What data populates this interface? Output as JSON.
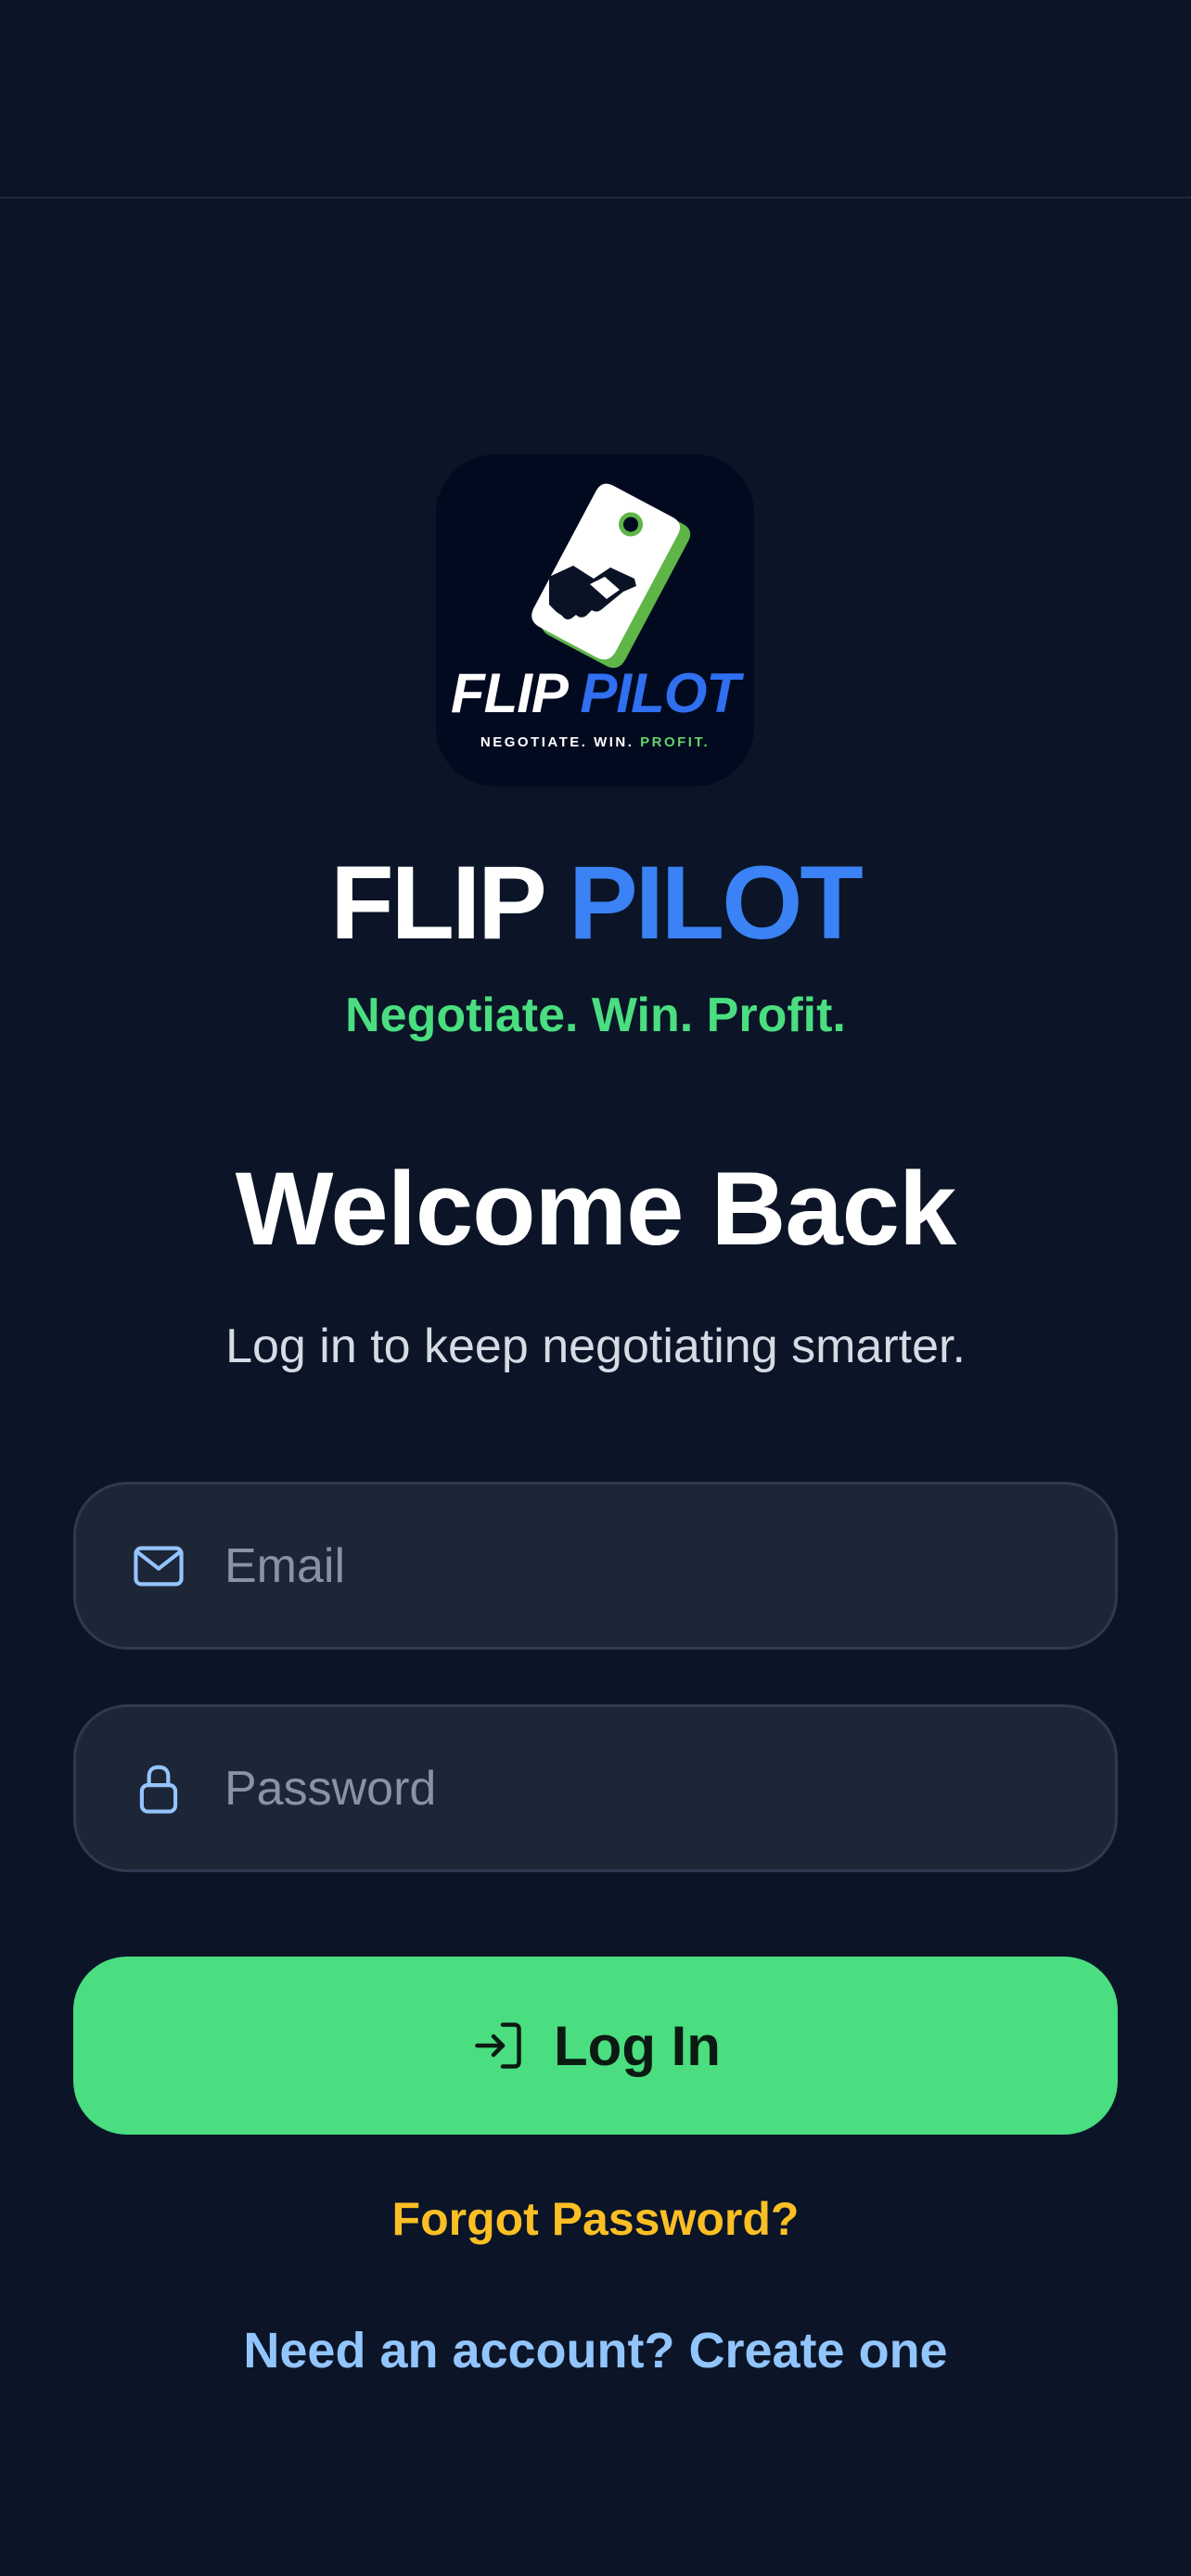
{
  "logo": {
    "word_part1": "FLIP",
    "word_part2": "PILOT",
    "sub_part1": "NEGOTIATE. WIN.",
    "sub_part2": "PROFIT.",
    "icon": "price-tag-handshake-icon"
  },
  "brand": {
    "title_part1": "FLIP",
    "title_part2": "PILOT",
    "tagline": "Negotiate. Win. Profit."
  },
  "heading": {
    "title": "Welcome Back",
    "subtitle": "Log in to keep negotiating smarter."
  },
  "form": {
    "email_placeholder": "Email",
    "email_value": "",
    "email_icon": "mail-icon",
    "password_placeholder": "Password",
    "password_value": "",
    "password_icon": "lock-icon"
  },
  "actions": {
    "login_label": "Log In",
    "login_icon": "log-in-icon",
    "forgot_label": "Forgot Password?",
    "create_label": "Need an account? Create one"
  },
  "colors": {
    "background": "#0b1527",
    "accent_green": "#4ade80",
    "accent_blue": "#3b82f6",
    "link_yellow": "#fbbf24",
    "link_blue": "#93c5fd",
    "field_bg": "#1d2637"
  }
}
